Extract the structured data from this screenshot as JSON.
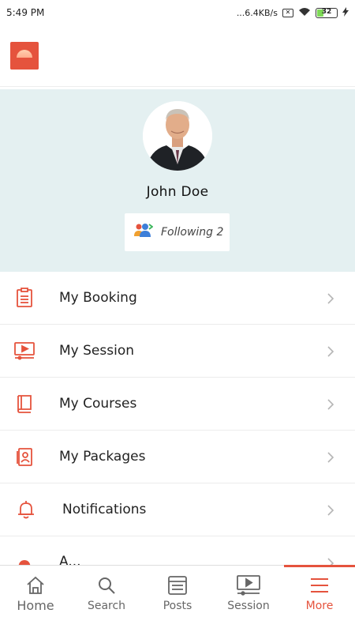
{
  "status_bar": {
    "time": "5:49 PM",
    "net_speed": "...6.4KB/s",
    "sim_symbol": "✕",
    "battery_level": "32"
  },
  "profile": {
    "name": "John Doe",
    "following_label": "Following 2"
  },
  "menu": {
    "items": [
      {
        "label": "My Booking",
        "icon": "clipboard-icon"
      },
      {
        "label": "My Session",
        "icon": "video-session-icon"
      },
      {
        "label": "My Courses",
        "icon": "book-icon"
      },
      {
        "label": "My Packages",
        "icon": "package-id-icon"
      },
      {
        "label": "Notifications",
        "icon": "bell-icon"
      },
      {
        "label": "A...",
        "icon": "partial-icon"
      }
    ]
  },
  "nav": {
    "items": [
      {
        "label": "Home",
        "icon": "home-icon"
      },
      {
        "label": "Search",
        "icon": "search-icon"
      },
      {
        "label": "Posts",
        "icon": "posts-icon"
      },
      {
        "label": "Session",
        "icon": "session-icon"
      },
      {
        "label": "More",
        "icon": "menu-icon",
        "active": true
      }
    ]
  },
  "colors": {
    "accent": "#e5533d",
    "profile_bg": "#e4f0f1"
  }
}
